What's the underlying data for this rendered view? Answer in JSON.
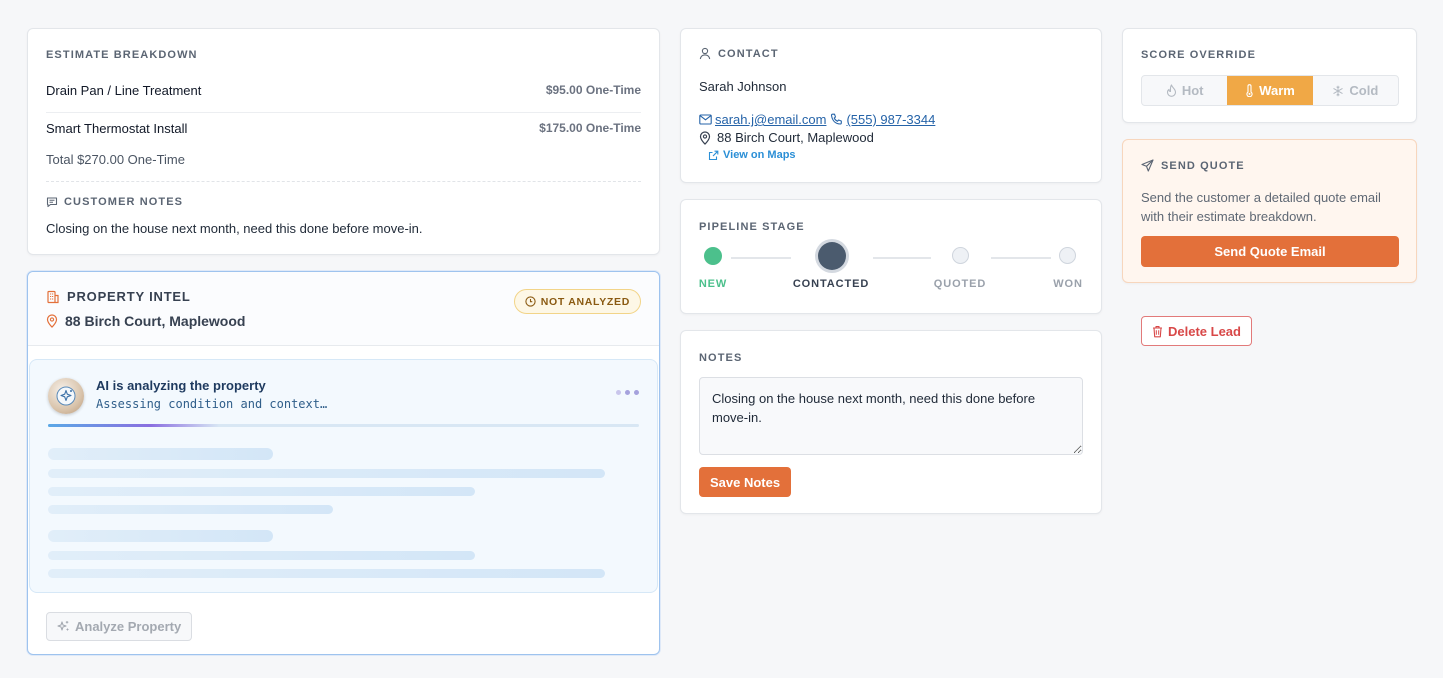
{
  "colors": {
    "accent_orange": "#e3703a",
    "warm_active": "#f0a846",
    "stage_new": "#4cc08c",
    "stage_contacted": "#4b5b6e",
    "link_blue": "#2563a8",
    "badge_amber": "#8a5a12",
    "danger_red": "#d84848"
  },
  "estimate": {
    "title": "ESTIMATE BREAKDOWN",
    "items": [
      {
        "name": "Drain Pan / Line Treatment",
        "price": "$95.00 One-Time"
      },
      {
        "name": "Smart Thermostat Install",
        "price": "$175.00 One-Time"
      }
    ],
    "total": "Total $270.00 One-Time",
    "customer_notes_label": "CUSTOMER NOTES",
    "customer_notes_icon": "message-icon",
    "customer_notes": "Closing on the house next month, need this done before move-in."
  },
  "property_intel": {
    "title": "PROPERTY INTEL",
    "title_icon": "building-icon",
    "address": "88 Birch Court, Maplewood",
    "address_icon": "map-pin-icon",
    "badge": "NOT ANALYZED",
    "ai_title": "AI is analyzing the property",
    "ai_status": "Assessing condition and context…",
    "analyze_button": "Analyze Property"
  },
  "contact": {
    "title": "CONTACT",
    "name": "Sarah Johnson",
    "email": "sarah.j@email.com",
    "phone": "(555) 987-3344",
    "address": "88 Birch Court, Maplewood",
    "maps_link": "View on Maps"
  },
  "pipeline": {
    "title": "PIPELINE STAGE",
    "stages": [
      {
        "label": "NEW",
        "state": "complete"
      },
      {
        "label": "CONTACTED",
        "state": "current"
      },
      {
        "label": "QUOTED",
        "state": "upcoming"
      },
      {
        "label": "WON",
        "state": "upcoming"
      }
    ]
  },
  "notes": {
    "title": "NOTES",
    "value": "Closing on the house next month, need this done before move-in.",
    "save_button": "Save Notes"
  },
  "score_override": {
    "title": "SCORE OVERRIDE",
    "options": [
      {
        "label": "Hot",
        "icon": "flame-icon"
      },
      {
        "label": "Warm",
        "icon": "thermometer-icon"
      },
      {
        "label": "Cold",
        "icon": "snowflake-icon"
      }
    ],
    "selected": "Warm"
  },
  "send_quote": {
    "title": "SEND QUOTE",
    "description": "Send the customer a detailed quote email with their estimate breakdown.",
    "button": "Send Quote Email"
  },
  "delete_button": "Delete Lead"
}
